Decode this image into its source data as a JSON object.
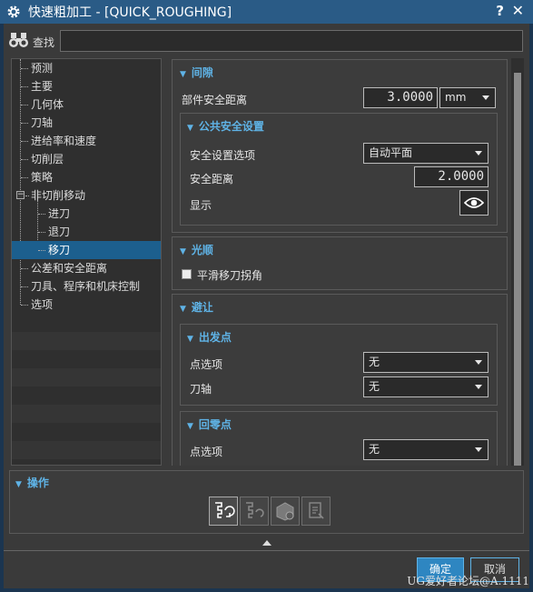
{
  "window": {
    "title": "快速粗加工 - [QUICK_ROUGHING]",
    "help_label": "?",
    "close_label": "✕"
  },
  "search": {
    "label": "查找",
    "value": ""
  },
  "tree": {
    "items": [
      {
        "label": "预测"
      },
      {
        "label": "主要"
      },
      {
        "label": "几何体"
      },
      {
        "label": "刀轴"
      },
      {
        "label": "进给率和速度"
      },
      {
        "label": "切削层"
      },
      {
        "label": "策略"
      },
      {
        "label": "非切削移动"
      },
      {
        "label": "进刀"
      },
      {
        "label": "退刀"
      },
      {
        "label": "移刀"
      },
      {
        "label": "公差和安全距离"
      },
      {
        "label": "刀具、程序和机床控制"
      },
      {
        "label": "选项"
      }
    ],
    "selected": "移刀",
    "expander_symbol": "−"
  },
  "clearance": {
    "header": "间隙",
    "part_safe_label": "部件安全距离",
    "part_safe_value": "3.0000",
    "unit": "mm",
    "common": {
      "header": "公共安全设置",
      "option_label": "安全设置选项",
      "option_value": "自动平面",
      "distance_label": "安全距离",
      "distance_value": "2.0000",
      "display_label": "显示"
    }
  },
  "smoothing": {
    "header": "光顺",
    "checkbox_label": "平滑移刀拐角",
    "checked": false
  },
  "avoidance": {
    "header": "避让",
    "from_point": {
      "header": "出发点",
      "point_option_label": "点选项",
      "point_option_value": "无",
      "tool_axis_label": "刀轴",
      "tool_axis_value": "无"
    },
    "return_point": {
      "header": "回零点",
      "point_option_label": "点选项",
      "point_option_value": "无"
    }
  },
  "operation": {
    "header": "操作"
  },
  "footer": {
    "ok_label": "确定",
    "cancel_label": "取消",
    "watermark": "UG爱好者论坛@A.1111"
  },
  "colors": {
    "titlebar": "#2a5b86",
    "accent": "#5fb3e6",
    "selection": "#1c5f8e",
    "panel": "#3a3a3a"
  }
}
